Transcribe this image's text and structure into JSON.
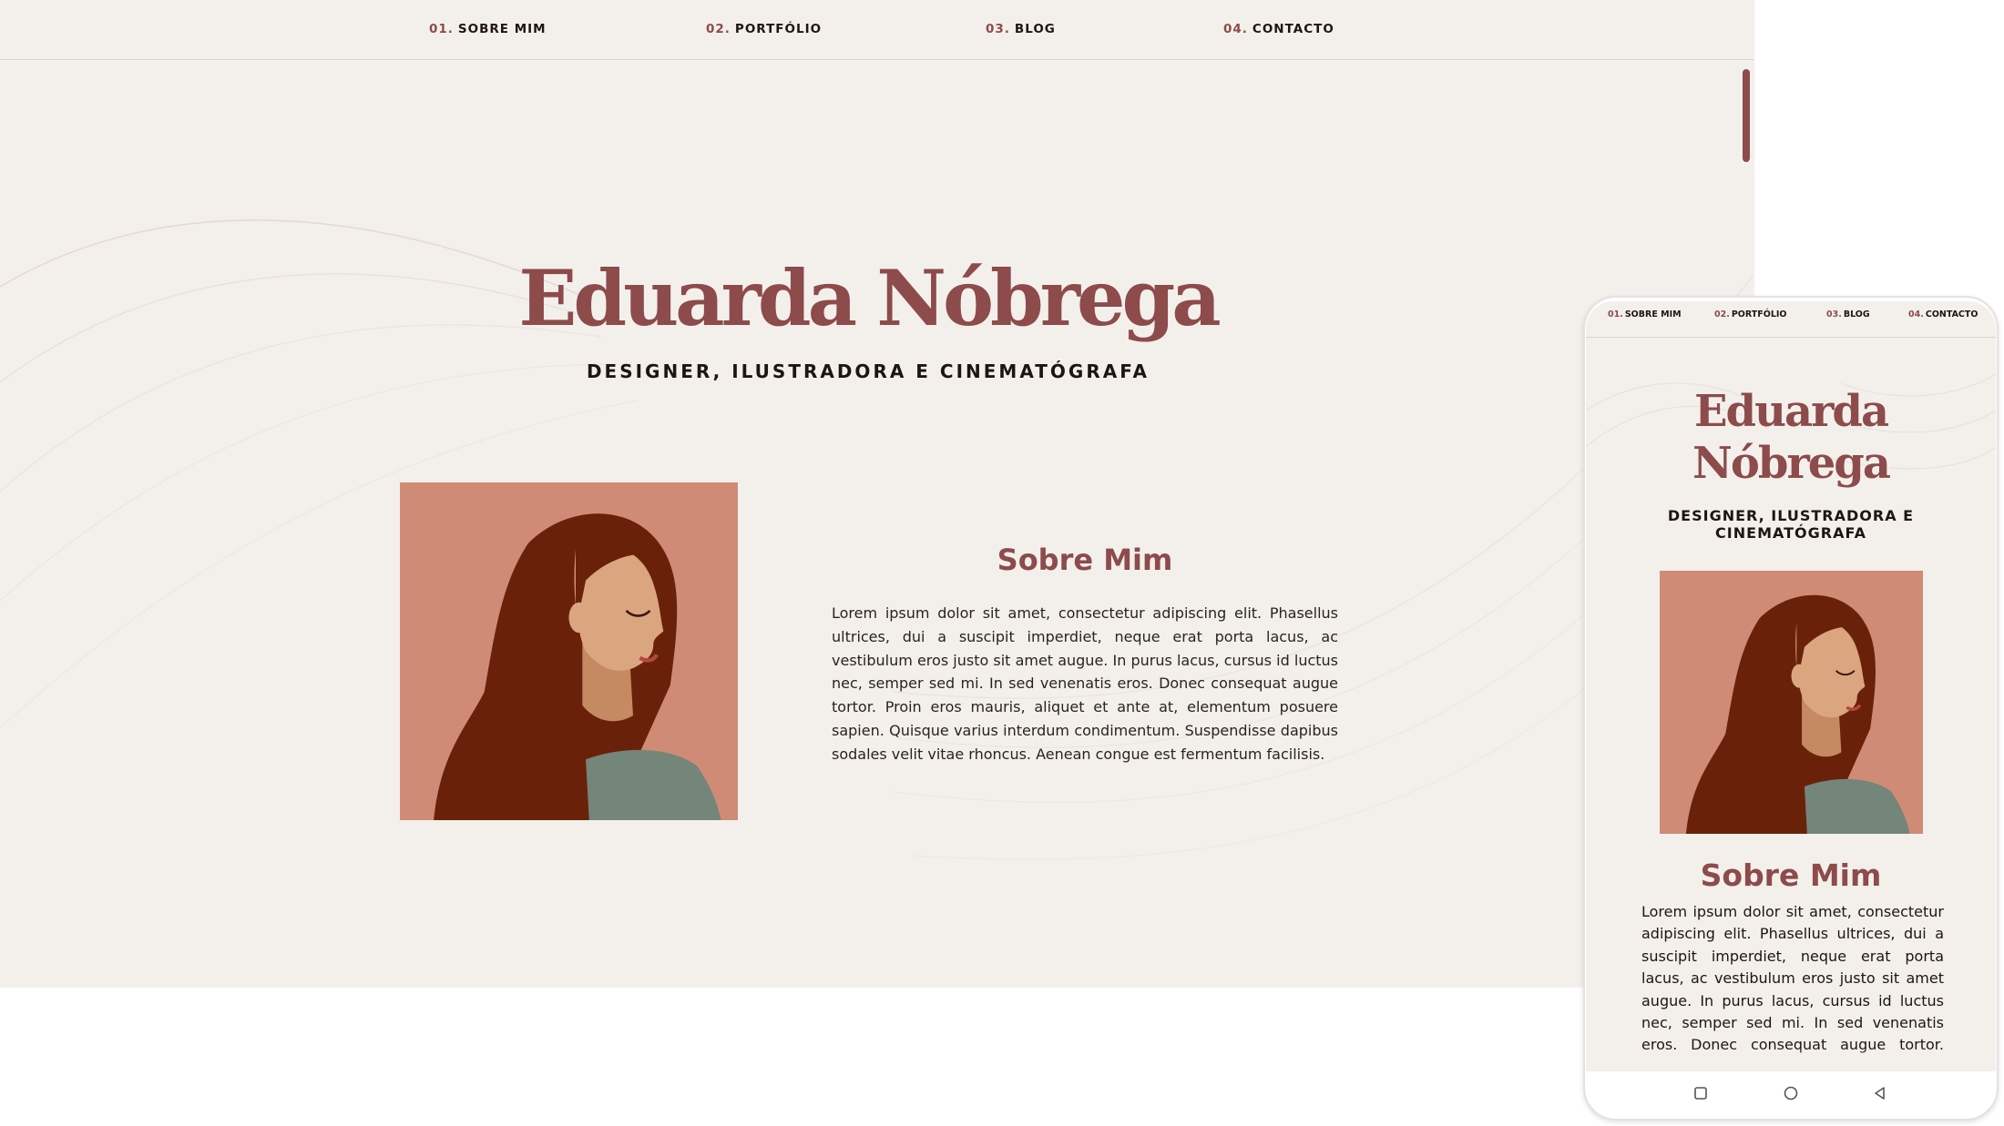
{
  "colors": {
    "accent": "#8d4b4b",
    "page_background": "#f3f0ec",
    "text": "#1e1414",
    "portrait_background": "#cf8b76",
    "hair": "#6a2109",
    "skin": "#dba57f",
    "sweater": "#74857a"
  },
  "nav": {
    "items": [
      {
        "num": "01.",
        "label": "SOBRE MIM"
      },
      {
        "num": "02.",
        "label": "PORTFÓLIO"
      },
      {
        "num": "03.",
        "label": "BLOG"
      },
      {
        "num": "04.",
        "label": "CONTACTO"
      }
    ]
  },
  "hero": {
    "name": "Eduarda Nóbrega",
    "name_line1": "Eduarda",
    "name_line2": "Nóbrega",
    "subtitle": "DESIGNER, ILUSTRADORA E CINEMATÓGRAFA",
    "subtitle_line1": "DESIGNER, ILUSTRADORA E",
    "subtitle_line2": "CINEMATÓGRAFA"
  },
  "about": {
    "title": "Sobre Mim",
    "text": "Lorem ipsum dolor sit amet, consectetur adipiscing elit. Phasellus ultrices, dui a suscipit imperdiet, neque erat porta lacus, ac vestibulum eros justo sit amet augue. In purus lacus, cursus id luctus nec, semper sed mi. In sed venenatis eros. Donec consequat augue tortor. Proin eros mauris, aliquet et ante at, elementum posuere sapien. Quisque varius interdum condimentum. Suspendisse dapibus sodales velit vitae rhoncus. Aenean congue est fermentum facilisis."
  },
  "icons": {
    "portrait": "woman-illustration-icon",
    "android_nav": [
      "recent-apps-icon",
      "home-icon",
      "back-icon"
    ]
  }
}
